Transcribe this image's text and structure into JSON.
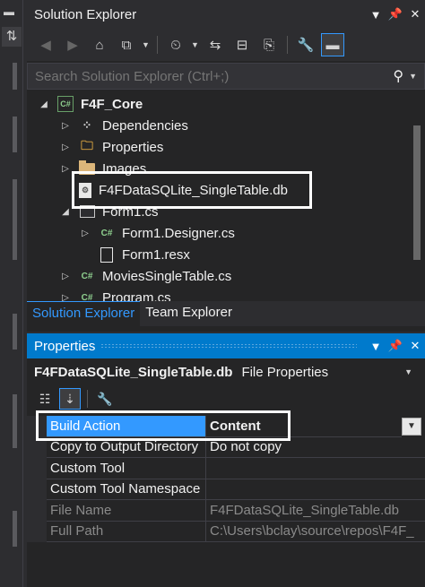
{
  "colors": {
    "accent": "#007acc",
    "selection": "#3399ff",
    "panel_bg": "#252526",
    "chrome_bg": "#2d2d30"
  },
  "solution_explorer": {
    "title": "Solution Explorer",
    "search_placeholder": "Search Solution Explorer (Ctrl+;)",
    "tree": [
      {
        "label": "F4F_Core",
        "icon": "csharp-project-icon",
        "expanded": true
      },
      {
        "label": "Dependencies",
        "icon": "dependencies-icon"
      },
      {
        "label": "Properties",
        "icon": "properties-folder-icon"
      },
      {
        "label": "Images",
        "icon": "folder-icon"
      },
      {
        "label": "F4FDataSQLite_SingleTable.db",
        "icon": "database-file-icon"
      },
      {
        "label": "Form1.cs",
        "icon": "form-icon",
        "expanded": true
      },
      {
        "label": "Form1.Designer.cs",
        "icon": "csharp-file-icon"
      },
      {
        "label": "Form1.resx",
        "icon": "resx-file-icon"
      },
      {
        "label": "MoviesSingleTable.cs",
        "icon": "csharp-file-icon"
      },
      {
        "label": "Program.cs",
        "icon": "csharp-file-icon"
      }
    ],
    "tabs": [
      "Solution Explorer",
      "Team Explorer"
    ]
  },
  "properties": {
    "title": "Properties",
    "object_name": "F4FDataSQLite_SingleTable.db",
    "object_type": "File Properties",
    "rows": [
      {
        "name": "Build Action",
        "value": "Content"
      },
      {
        "name": "Copy to Output Directory",
        "value": "Do not copy"
      },
      {
        "name": "Custom Tool",
        "value": ""
      },
      {
        "name": "Custom Tool Namespace",
        "value": ""
      },
      {
        "name": "File Name",
        "value": "F4FDataSQLite_SingleTable.db"
      },
      {
        "name": "Full Path",
        "value": "C:\\Users\\bclay\\source\\repos\\F4F_"
      }
    ]
  }
}
